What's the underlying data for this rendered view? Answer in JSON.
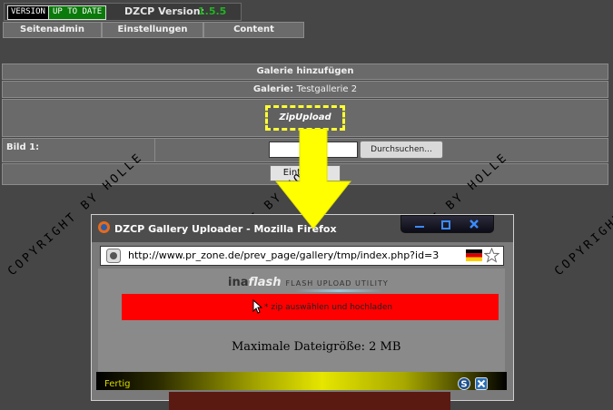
{
  "topbar": {
    "badge_version": "VERSION",
    "badge_status": "UP TO DATE",
    "dzcp_label": "DZCP Version:",
    "dzcp_value": "1.5.5"
  },
  "nav": {
    "items": [
      "Seitenadmin",
      "Einstellungen",
      "Content"
    ]
  },
  "form": {
    "header": "Galerie hinzufügen",
    "gallery_label": "Galerie:",
    "gallery_name": "Testgallerie 2",
    "zip_button": "ZipUpload",
    "image_label": "Bild 1:",
    "browse_button": "Durchsuchen...",
    "submit_button": "Eintragen"
  },
  "watermark": "COPYRIGHT BY HOLLE",
  "popup": {
    "title": "DZCP Gallery Uploader - Mozilla Firefox",
    "url": "http://www.pr_zone.de/prev_page/gallery/tmp/index.php?id=3",
    "brand_ina": "ina",
    "brand_flash": "flash",
    "brand_tagline": "FLASH UPLOAD UTILITY",
    "upload_text": "* zip auswählen und hochladen",
    "max_size": "Maximale Dateigröße: 2 MB",
    "status": "Fertig"
  },
  "icons": [
    "firefox-icon",
    "minimize-icon",
    "restore-icon",
    "close-icon",
    "site-icon",
    "german-flag-icon",
    "bookmark-star-icon",
    "cursor-icon",
    "status-s-icon",
    "status-x-icon",
    "down-arrow-annotation"
  ],
  "colors": {
    "background": "#464646",
    "highlight": "#ffff33",
    "upload_bar": "#ff0000",
    "version_ok": "#22b322"
  }
}
